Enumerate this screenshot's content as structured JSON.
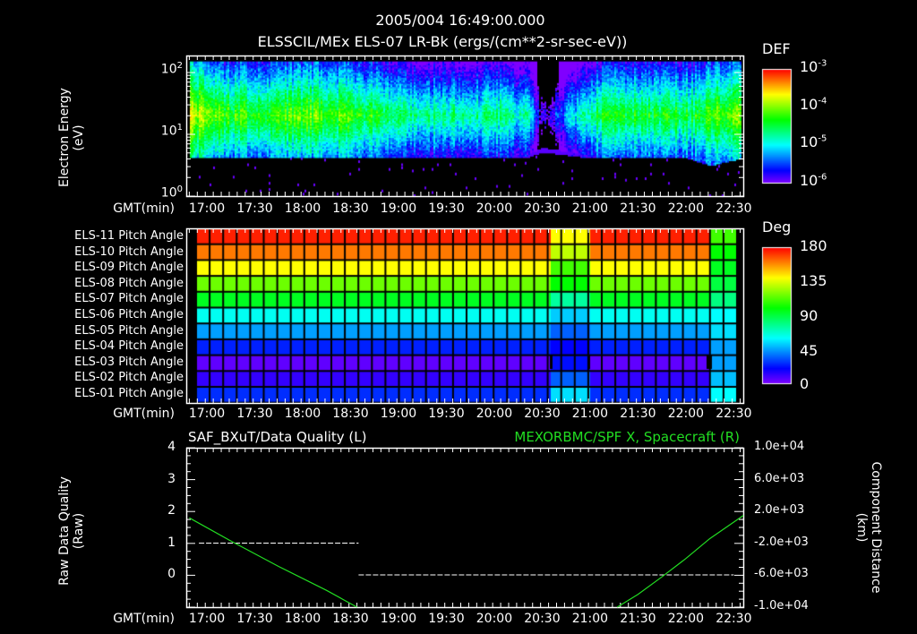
{
  "header": {
    "title": "2005/004 16:49:00.000",
    "subtitle": "ELSSCIL/MEx ELS-07 LR-Bk  (ergs/(cm**2-sr-sec-eV))"
  },
  "time_axis": {
    "label": "GMT(min)",
    "ticks": [
      "17:00",
      "17:30",
      "18:00",
      "18:30",
      "19:00",
      "19:30",
      "20:00",
      "20:30",
      "21:00",
      "21:30",
      "22:00",
      "22:30"
    ]
  },
  "chart_data": [
    {
      "type": "heatmap",
      "title": "ELSSCIL/MEx ELS-07 LR-Bk (ergs/(cm**2-sr-sec-eV))",
      "ylabel_line1": "Electron Energy",
      "ylabel_line2": "(eV)",
      "yscale": "log",
      "ylim": [
        1,
        180
      ],
      "yticks": [
        {
          "base": "10",
          "exp": "0"
        },
        {
          "base": "10",
          "exp": "1"
        },
        {
          "base": "10",
          "exp": "2"
        }
      ],
      "xlim_minutes_from_1649": [
        0,
        347
      ],
      "colorbar": {
        "label": "DEF",
        "scale": "log",
        "range": [
          1e-06,
          0.001
        ],
        "ticks": [
          {
            "base": "10",
            "exp": "-3"
          },
          {
            "base": "10",
            "exp": "-4"
          },
          {
            "base": "10",
            "exp": "-5"
          },
          {
            "base": "10",
            "exp": "-6"
          }
        ]
      },
      "profile": {
        "time": [
          "16:49",
          "17:00",
          "17:30",
          "18:00",
          "18:30",
          "19:00",
          "19:30",
          "20:00",
          "20:20",
          "20:30",
          "21:00",
          "21:30",
          "22:00",
          "22:15",
          "22:36"
        ],
        "peak_log_def": [
          -3.6,
          -4.1,
          -4.3,
          -4.1,
          -4.2,
          -4.6,
          -4.7,
          -4.6,
          -4.8,
          -6.0,
          -4.5,
          -4.3,
          -4.4,
          -4.2,
          -3.9
        ],
        "low_energy_cutoff_eV": [
          4,
          4,
          4,
          4,
          4,
          4,
          4,
          4,
          4,
          5,
          4,
          4,
          4,
          3,
          4
        ]
      }
    },
    {
      "type": "heatmap",
      "rows": [
        "ELS-11 Pitch Angle",
        "ELS-10 Pitch Angle",
        "ELS-09 Pitch Angle",
        "ELS-08 Pitch Angle",
        "ELS-07 Pitch Angle",
        "ELS-06 Pitch Angle",
        "ELS-05 Pitch Angle",
        "ELS-04 Pitch Angle",
        "ELS-03 Pitch Angle",
        "ELS-02 Pitch Angle",
        "ELS-01 Pitch Angle"
      ],
      "pitch_angle_deg_typical": [
        175,
        161,
        140,
        117,
        95,
        62,
        45,
        25,
        5,
        12,
        27
      ],
      "pitch_angle_deg_2035_2100": [
        140,
        130,
        110,
        100,
        75,
        52,
        35,
        20,
        22,
        35,
        55
      ],
      "pitch_angle_deg_2215_2236": [
        110,
        100,
        95,
        90,
        80,
        60,
        55,
        45,
        45,
        50,
        60
      ],
      "colorbar": {
        "label": "Deg",
        "range": [
          0,
          180
        ],
        "ticks": [
          "180",
          "135",
          "90",
          "45",
          "0"
        ]
      }
    },
    {
      "type": "line",
      "left_title": "SAF_BXuT/Data Quality (L)",
      "right_title": "MEXORBMC/SPF X, Spacecraft (R)",
      "ylabel_left_line1": "Raw Data Quality",
      "ylabel_left_line2": "(Raw)",
      "ylabel_right_line1": "Component Distance",
      "ylabel_right_line2": "(km)",
      "ylim_left": [
        -1,
        4
      ],
      "yticks_left": [
        "4",
        "3",
        "2",
        "1",
        "0"
      ],
      "ylim_right": [
        -10000,
        10000
      ],
      "yticks_right": [
        "1.0e+04",
        "6.0e+03",
        "2.0e+03",
        "-2.0e+03",
        "-6.0e+03",
        "-1.0e+04"
      ],
      "series": [
        {
          "name": "Data Quality",
          "axis": "left",
          "color": "#ffffff",
          "style": "dashed",
          "segments": [
            {
              "from": "16:55",
              "to": "18:35",
              "value": 1
            },
            {
              "from": "18:35",
              "to": "22:30",
              "value": 0
            }
          ]
        },
        {
          "name": "SPF X",
          "axis": "right",
          "color": "#22dd22",
          "x": [
            "16:49",
            "17:15",
            "17:45",
            "18:15",
            "18:34",
            "21:17",
            "21:30",
            "21:45",
            "22:00",
            "22:15",
            "22:36"
          ],
          "y": [
            1200,
            -1700,
            -4900,
            -7900,
            -10000,
            -10000,
            -8400,
            -6200,
            -3900,
            -1400,
            1500
          ]
        }
      ]
    }
  ]
}
